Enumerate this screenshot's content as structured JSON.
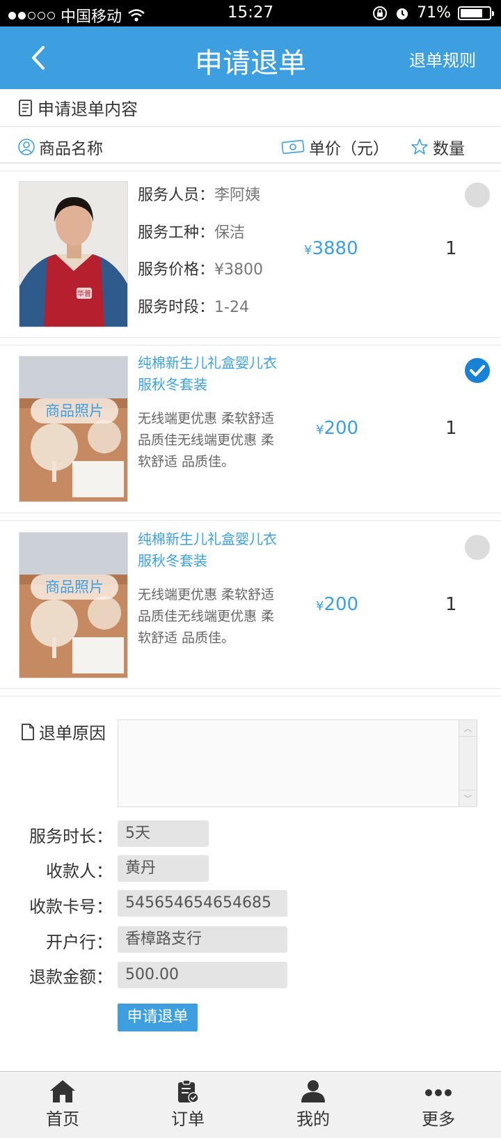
{
  "status_bar": {
    "carrier": "中国移动",
    "time": "15:27",
    "battery": "71%"
  },
  "nav": {
    "title": "申请退单",
    "rules_link": "退单规则"
  },
  "section": {
    "title": "申请退单内容"
  },
  "columns": {
    "name": "商品名称",
    "unit_price": "单价（元）",
    "quantity": "数量"
  },
  "service_item": {
    "staff_label": "服务人员：",
    "staff_value": "李阿姨",
    "type_label": "服务工种：",
    "type_value": "保洁",
    "price_label": "服务价格：",
    "price_value": "¥3800",
    "period_label": "服务时段：",
    "period_value": "1-24",
    "unit_price_symbol": "¥",
    "unit_price_value": "3880",
    "quantity": "1",
    "apron_text": "华普",
    "selected": false
  },
  "products": [
    {
      "photo_label": "商品照片",
      "title": "纯棉新生儿礼盒婴儿衣服秋冬套装",
      "description": "无线端更优惠 柔软舒适 品质佳无线端更优惠 柔软舒适 品质佳。",
      "price_symbol": "¥",
      "price_value": "200",
      "quantity": "1",
      "selected": true
    },
    {
      "photo_label": "商品照片",
      "title": "纯棉新生儿礼盒婴儿衣服秋冬套装",
      "description": "无线端更优惠 柔软舒适 品质佳无线端更优惠 柔软舒适 品质佳。",
      "price_symbol": "¥",
      "price_value": "200",
      "quantity": "1",
      "selected": false
    }
  ],
  "form": {
    "reason_label": "退单原因",
    "reason_value": "",
    "duration_label": "服务时长：",
    "duration_value": "5天",
    "payee_label": "收款人：",
    "payee_value": "黄丹",
    "card_label": "收款卡号：",
    "card_value": "545654654654685",
    "bank_label": "开户行：",
    "bank_value": "香樟路支行",
    "amount_label": "退款金额：",
    "amount_value": "500.00",
    "submit_label": "申请退单"
  },
  "tabs": [
    {
      "label": "首页",
      "icon": "home-icon"
    },
    {
      "label": "订单",
      "icon": "order-icon"
    },
    {
      "label": "我的",
      "icon": "user-icon"
    },
    {
      "label": "更多",
      "icon": "more-icon"
    }
  ],
  "colors": {
    "accent": "#3e9fe0",
    "checked": "#1a82d6",
    "field_bg": "#e4e4e4"
  }
}
